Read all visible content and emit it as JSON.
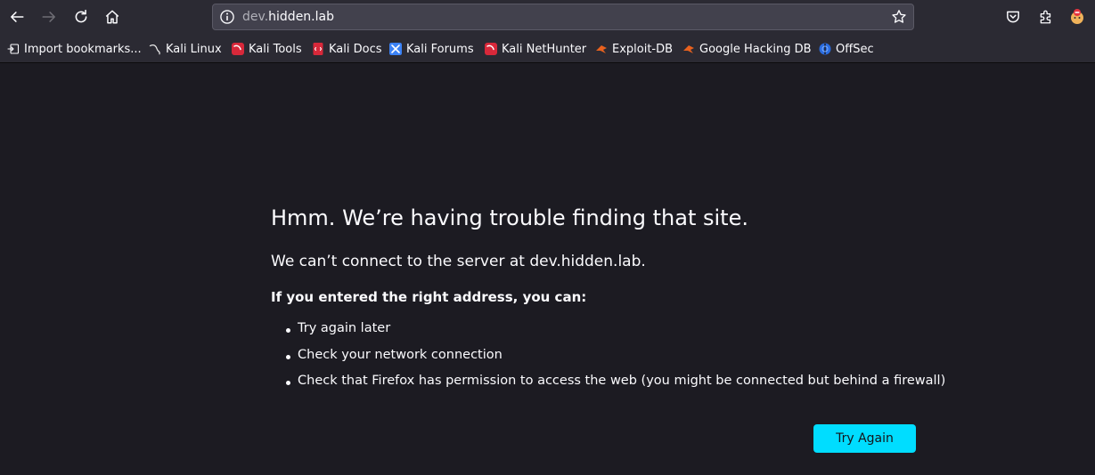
{
  "browser": {
    "url_prefix": "dev.",
    "url_domain": "hidden.lab"
  },
  "bookmarks": [
    {
      "label": "Import bookmarks...",
      "icon": "import-icon"
    },
    {
      "label": "Kali Linux",
      "icon": "kali-dragon-icon"
    },
    {
      "label": "Kali Tools",
      "icon": "kali-tools-icon"
    },
    {
      "label": "Kali Docs",
      "icon": "kali-docs-icon"
    },
    {
      "label": "Kali Forums",
      "icon": "kali-forums-icon"
    },
    {
      "label": "Kali NetHunter",
      "icon": "kali-nethunter-icon"
    },
    {
      "label": "Exploit-DB",
      "icon": "exploit-db-icon"
    },
    {
      "label": "Google Hacking DB",
      "icon": "ghdb-icon"
    },
    {
      "label": "OffSec",
      "icon": "offsec-icon"
    }
  ],
  "error": {
    "title": "Hmm. We’re having trouble finding that site.",
    "subtitle": "We can’t connect to the server at dev.hidden.lab.",
    "intro": "If you entered the right address, you can:",
    "tips": [
      "Try again later",
      "Check your network connection",
      "Check that Firefox has permission to access the web (you might be connected but behind a firewall)"
    ],
    "button": "Try Again"
  },
  "colors": {
    "toolbar": "#2b2a33",
    "page": "#1c1b22",
    "accent": "#00ddff"
  }
}
